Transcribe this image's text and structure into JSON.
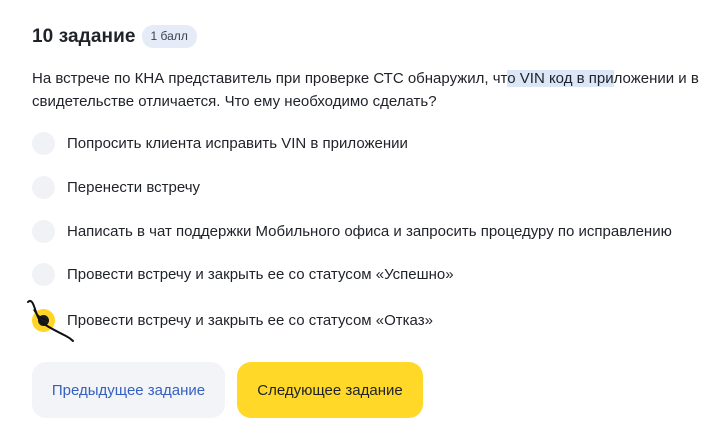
{
  "task": {
    "title": "10 задание",
    "points_badge": "1 балл"
  },
  "question": {
    "part1": "На встрече по КНА представитель при проверке СТС обнаружил, чт",
    "highlighted": "о VIN код в при",
    "part2": "ложении и в свидетельстве отличается. Что ему необходимо сделать?"
  },
  "options": [
    {
      "label": "Попросить клиента исправить VIN в приложении",
      "selected": false
    },
    {
      "label": "Перенести встречу",
      "selected": false
    },
    {
      "label": "Написать в чат поддержки Мобильного офиса и запросить процедуру по исправлению",
      "selected": false
    },
    {
      "label": "Провести встречу и закрыть ее со статусом «Успешно»",
      "selected": false
    },
    {
      "label": "Провести встречу и закрыть ее со статусом «Отказ»",
      "selected": true
    }
  ],
  "buttons": {
    "prev_label": "Предыдущее задание",
    "next_label": "Следующее задание"
  },
  "colors": {
    "accent_yellow": "#ffd828",
    "link_blue": "#3560c0",
    "badge_bg": "#e6ecf7",
    "highlight": "#dbe6f6"
  }
}
